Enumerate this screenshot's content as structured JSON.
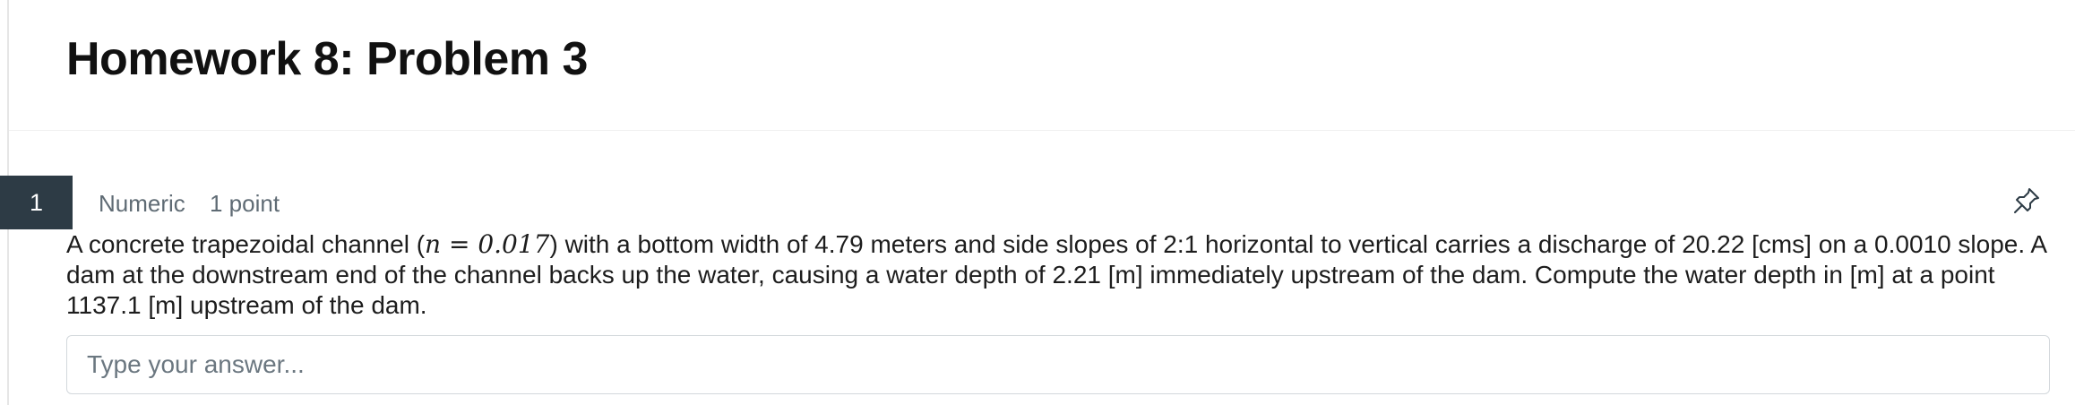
{
  "header": {
    "title": "Homework 8: Problem 3"
  },
  "question": {
    "number": "1",
    "type": "Numeric",
    "points": "1 point",
    "text_before_math": "A concrete trapezoidal channel (",
    "math": "n = 0.017",
    "text_after_math": ") with a bottom width of 4.79 meters and side slopes of 2:1 horizontal to vertical carries a discharge of 20.22 [cms] on a 0.0010 slope. A dam at the downstream end of the channel backs up the water, causing a water depth of 2.21 [m] immediately upstream of the dam. Compute the water depth in [m] at a point 1137.1 [m] upstream of the dam.",
    "pin_icon": "pin-icon"
  },
  "answer": {
    "placeholder": "Type your answer...",
    "value": ""
  }
}
